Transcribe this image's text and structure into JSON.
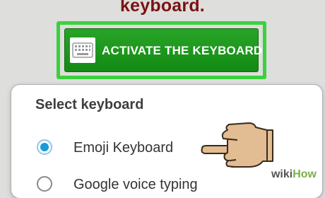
{
  "heading": "keyboard.",
  "activate_button": {
    "label": "ACTIVATE THE KEYBOARD",
    "icon": "keyboard-icon"
  },
  "dialog": {
    "title": "Select keyboard",
    "options": [
      {
        "label": "Emoji Keyboard",
        "selected": true
      },
      {
        "label": "Google voice typing",
        "selected": false
      }
    ]
  },
  "watermark": {
    "prefix": "wiki",
    "suffix": "How"
  },
  "colors": {
    "heading": "#7a1212",
    "button": "#1e961e",
    "highlight": "#3ad13c",
    "radio_selected": "#1a9ad6"
  }
}
